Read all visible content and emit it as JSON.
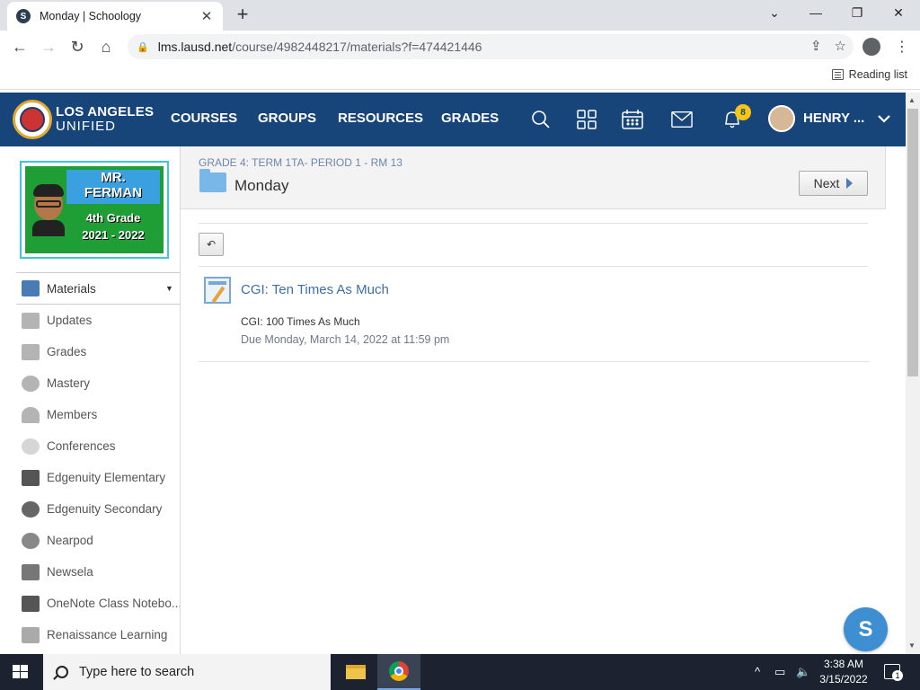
{
  "browser": {
    "tab_title": "Monday | Schoology",
    "tab_favicon": "S",
    "url_host": "lms.lausd.net",
    "url_path": "/course/4982448217/materials?f=474421446",
    "reading_list": "Reading list"
  },
  "header": {
    "logo_line1": "LOS ANGELES",
    "logo_line2": "UNIFIED",
    "nav": [
      "COURSES",
      "GROUPS",
      "RESOURCES",
      "GRADES"
    ],
    "notification_count": "8",
    "user_name": "HENRY ..."
  },
  "course_image": {
    "line1": "MR.",
    "line2": "FERMAN",
    "line3": "4th Grade",
    "line4": "2021 - 2022"
  },
  "sidebar": {
    "items": [
      {
        "label": "Materials",
        "icon": "materials-icon"
      },
      {
        "label": "Updates",
        "icon": "updates-icon"
      },
      {
        "label": "Grades",
        "icon": "grades-icon"
      },
      {
        "label": "Mastery",
        "icon": "mastery-icon"
      },
      {
        "label": "Members",
        "icon": "members-icon"
      },
      {
        "label": "Conferences",
        "icon": "conferences-icon"
      },
      {
        "label": "Edgenuity Elementary",
        "icon": "edgenuity-icon"
      },
      {
        "label": "Edgenuity Secondary",
        "icon": "edgenuity-icon"
      },
      {
        "label": "Nearpod",
        "icon": "nearpod-icon"
      },
      {
        "label": "Newsela",
        "icon": "newsela-icon"
      },
      {
        "label": "OneNote Class Notebo...",
        "icon": "onenote-icon"
      },
      {
        "label": "Renaissance Learning",
        "icon": "renaissance-icon"
      }
    ]
  },
  "main": {
    "breadcrumb": "GRADE 4: TERM 1TA- PERIOD 1 - RM 13",
    "title": "Monday",
    "next_label": "Next",
    "back_symbol": "↶",
    "assignment": {
      "title": "CGI: Ten Times As Much",
      "description": "CGI: 100 Times As Much",
      "due": "Due Monday, March 14, 2022 at 11:59 pm"
    }
  },
  "chat_button": "S",
  "taskbar": {
    "search_placeholder": "Type here to search",
    "time": "3:38 AM",
    "date": "3/15/2022",
    "notification_count": "1"
  },
  "colors": {
    "header_bg": "#17457a",
    "link": "#3d6ea8",
    "badge": "#f6c515"
  }
}
